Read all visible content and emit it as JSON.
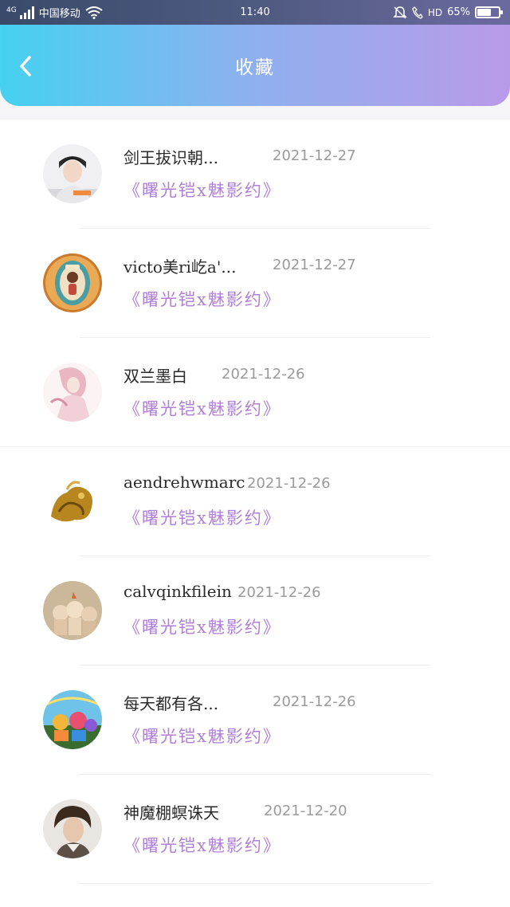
{
  "status_bar": {
    "network": "4G",
    "carrier": "中国移动",
    "time": "11:40",
    "hd": "HD",
    "battery_percent": "65%",
    "battery_level": 0.65
  },
  "header": {
    "title": "收藏"
  },
  "items": [
    {
      "name": "剑王拔识朝...",
      "date": "2021-12-27",
      "tag": "《曙光铠x魅影约》"
    },
    {
      "name": "victo美ri屹a'...",
      "date": "2021-12-27",
      "tag": "《曙光铠x魅影约》"
    },
    {
      "name": "双兰墨白",
      "date": "2021-12-26",
      "tag": "《曙光铠x魅影约》"
    },
    {
      "name": "aendrehwmarc",
      "date": "2021-12-26",
      "tag": "《曙光铠x魅影约》"
    },
    {
      "name": "calvqinkfilein",
      "date": "2021-12-26",
      "tag": "《曙光铠x魅影约》"
    },
    {
      "name": "每天都有各...",
      "date": "2021-12-26",
      "tag": "《曙光铠x魅影约》"
    },
    {
      "name": "神魔棚螟诛天",
      "date": "2021-12-20",
      "tag": "《曙光铠x魅影约》"
    }
  ]
}
